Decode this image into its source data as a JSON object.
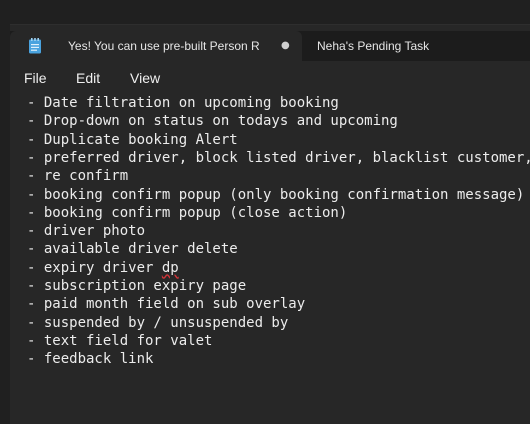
{
  "tabs": {
    "active_title": "Yes! You can use pre-built Person R",
    "other_title": "Neha's Pending Task",
    "modified_marker": "●"
  },
  "menu": [
    "File",
    "Edit",
    "View"
  ],
  "lines": [
    "- Date filtration on upcoming booking",
    "- Drop-down on status on todays and upcoming",
    "- Duplicate booking Alert",
    "- preferred driver, block listed driver, blacklist customer,",
    "- re confirm",
    "- booking confirm popup (only booking confirmation message)",
    "- booking confirm popup (close action)",
    "- driver photo",
    "- available driver delete",
    "- expiry driver ",
    "- subscription expiry page",
    "- paid month field on sub overlay",
    "- suspended by / unsuspended by",
    "- text field for valet",
    "- feedback link"
  ],
  "misspelled_word": "dp",
  "colors": {
    "background": "#272727",
    "tab_bar": "#1c1c1c",
    "text": "#ececec",
    "spellcheck_underline": "#d13438",
    "icon": "#4aa3df"
  },
  "icons": {
    "app": "notepad-icon"
  }
}
